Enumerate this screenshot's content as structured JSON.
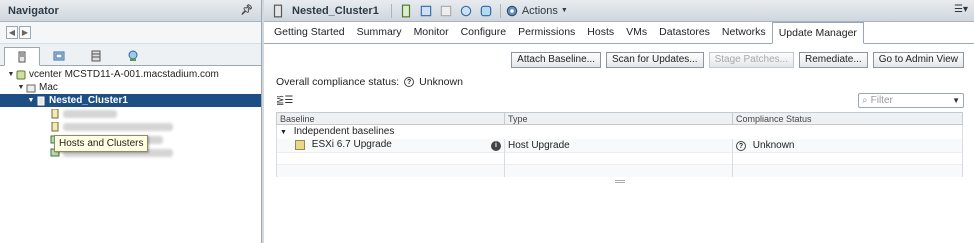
{
  "navigator": {
    "title": "Navigator",
    "tooltip": "Hosts and Clusters",
    "tree": {
      "vcenter_label": "vcenter MCSTD11-A-001.macstadium.com",
      "datacenter_label": "Mac",
      "cluster_label": "Nested_Cluster1"
    }
  },
  "object": {
    "title": "Nested_Cluster1",
    "actions_label": "Actions"
  },
  "tabs": [
    "Getting Started",
    "Summary",
    "Monitor",
    "Configure",
    "Permissions",
    "Hosts",
    "VMs",
    "Datastores",
    "Networks",
    "Update Manager"
  ],
  "active_tab": "Update Manager",
  "buttons": {
    "attach": "Attach Baseline...",
    "scan": "Scan for Updates...",
    "stage": "Stage Patches...",
    "remediate": "Remediate...",
    "admin": "Go to Admin View"
  },
  "compliance": {
    "label": "Overall compliance status:",
    "value": "Unknown"
  },
  "filter": {
    "placeholder": "Filter"
  },
  "table": {
    "columns": [
      "Baseline",
      "Type",
      "Compliance Status"
    ],
    "group_label": "Independent baselines",
    "rows": [
      {
        "baseline": "ESXi 6.7 Upgrade",
        "type": "Host Upgrade",
        "status": "Unknown"
      }
    ]
  },
  "colors": {
    "selection": "#1d4f84",
    "header_bg": "#cfd6dd",
    "tooltip_bg": "#ffffe1"
  }
}
